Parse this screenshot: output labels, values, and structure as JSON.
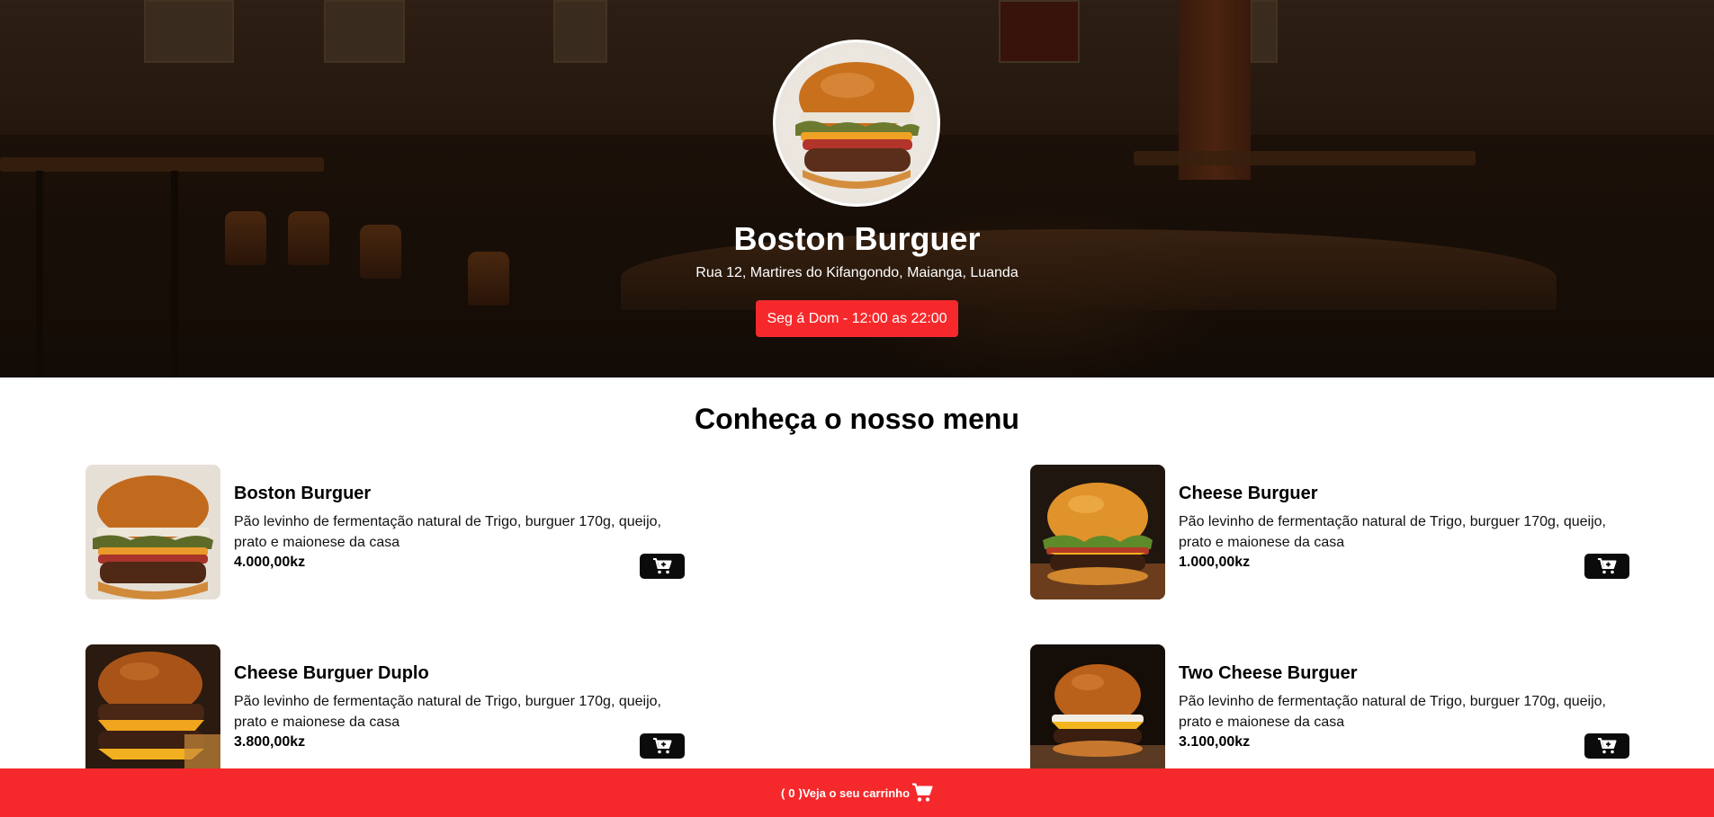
{
  "restaurant": {
    "name": "Boston Burguer",
    "address": "Rua 12, Martires do Kifangondo, Maianga, Luanda",
    "hours": "Seg á Dom - 12:00 as 22:00"
  },
  "menu": {
    "heading": "Conheça o nosso menu",
    "items": [
      {
        "name": "Boston Burguer",
        "description": "Pão levinho de fermentação natural de Trigo, burguer 170g, queijo, prato e maionese da casa",
        "price": "4.000,00kz"
      },
      {
        "name": "Cheese Burguer",
        "description": "Pão levinho de fermentação natural de Trigo, burguer 170g, queijo, prato e maionese da casa",
        "price": "1.000,00kz"
      },
      {
        "name": "Cheese Burguer Duplo",
        "description": "Pão levinho de fermentação natural de Trigo, burguer 170g, queijo, prato e maionese da casa",
        "price": "3.800,00kz"
      },
      {
        "name": "Two Cheese Burguer",
        "description": "Pão levinho de fermentação natural de Trigo, burguer 170g, queijo, prato e maionese da casa",
        "price": "3.100,00kz"
      }
    ]
  },
  "cart": {
    "open_paren": "(",
    "count": "0",
    "label": ")Veja o seu carrinho"
  },
  "colors": {
    "accent": "#f5292c",
    "button_dark": "#0b0b0b"
  },
  "icons": {
    "cart_button": "cart-plus-icon",
    "footer_cart": "shopping-cart-icon"
  }
}
